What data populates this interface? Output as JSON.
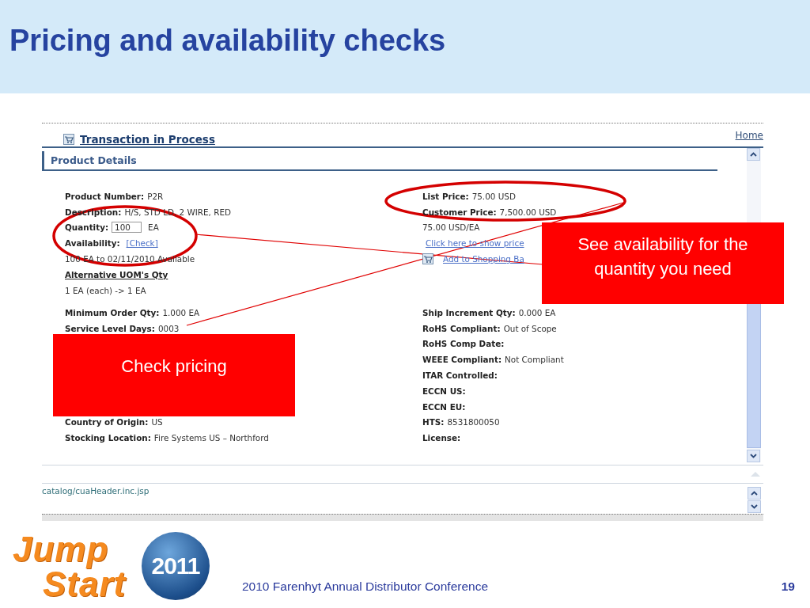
{
  "slide": {
    "title": "Pricing and availability checks"
  },
  "screen": {
    "page_link": "Transaction in Process",
    "home_link": "Home",
    "section_title": "Product Details",
    "left_top": [
      {
        "kind": "field",
        "label": "Product Number:",
        "value": "P2R"
      },
      {
        "kind": "field",
        "label": "Description:",
        "value": "H/S, STD LD, 2 WIRE, RED"
      },
      {
        "kind": "input",
        "label": "Quantity:",
        "value": "100",
        "unit": "EA"
      },
      {
        "kind": "link",
        "label": "Availability:",
        "value": "[Check]"
      },
      {
        "kind": "plain",
        "value": "100 EA to 02/11/2010 Available"
      },
      {
        "kind": "heading",
        "value": "Alternative UOM's Qty"
      },
      {
        "kind": "plain",
        "value": "1 EA (each) ->  1 EA"
      }
    ],
    "right_top": [
      {
        "kind": "field",
        "label": "List Price:",
        "value": "75.00 USD"
      },
      {
        "kind": "field",
        "label": "Customer Price:",
        "value": "7,500.00 USD"
      },
      {
        "kind": "plain",
        "value": "75.00 USD/EA"
      },
      {
        "kind": "link",
        "value": "Click here to show price"
      },
      {
        "kind": "cart",
        "value": "Add to Shopping Ba"
      }
    ],
    "left_bottom_upper": [
      {
        "kind": "field",
        "label": "Minimum Order Qty:",
        "value": "1.000  EA"
      },
      {
        "kind": "field",
        "label": "Service Level Days:",
        "value": "0003"
      }
    ],
    "left_bottom_lower": [
      {
        "kind": "field",
        "label": "Country of Origin:",
        "value": "US"
      },
      {
        "kind": "field",
        "label": "Stocking Location:",
        "value": "Fire Systems US – Northford"
      }
    ],
    "right_bottom": [
      {
        "kind": "field",
        "label": "Ship Increment Qty:",
        "value": "0.000  EA"
      },
      {
        "kind": "field",
        "label": "RoHS Compliant:",
        "value": "Out of Scope"
      },
      {
        "kind": "field",
        "label": "RoHS Comp Date:"
      },
      {
        "kind": "field",
        "label": "WEEE Compliant:",
        "value": "Not Compliant"
      },
      {
        "kind": "field",
        "label": "ITAR Controlled:"
      },
      {
        "kind": "field",
        "label": "ECCN US:"
      },
      {
        "kind": "field",
        "label": "ECCN EU:"
      },
      {
        "kind": "field",
        "label": "HTS:",
        "value": "8531800050"
      },
      {
        "kind": "field",
        "label": "License:"
      }
    ],
    "status_text": "catalog/cuaHeader.inc.jsp"
  },
  "callouts": [
    {
      "text": "See availability for the quantity you need"
    },
    {
      "text": "Check pricing"
    }
  ],
  "footer": {
    "logo_top": "Jump",
    "logo_bottom": "Start",
    "logo_year": "2011",
    "conference": "2010 Farenhyt Annual Distributor Conference",
    "page_number": "19"
  }
}
